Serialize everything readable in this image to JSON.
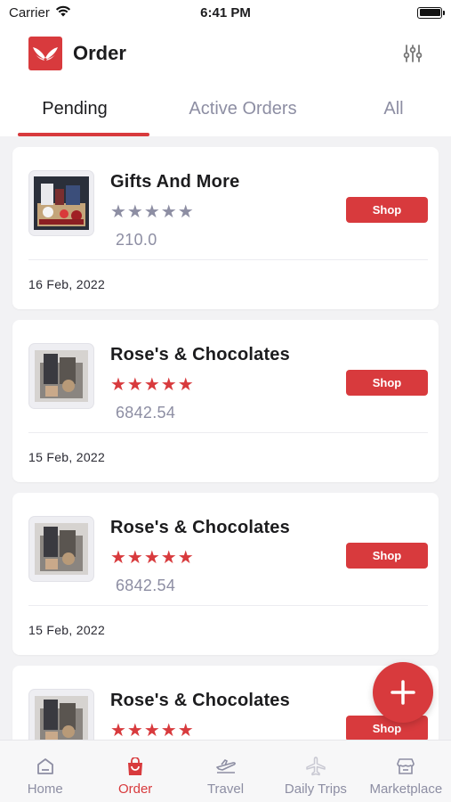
{
  "status_bar": {
    "carrier": "Carrier",
    "time": "6:41 PM"
  },
  "header": {
    "title": "Order"
  },
  "tabs": [
    {
      "label": "Pending",
      "active": true
    },
    {
      "label": "Active Orders",
      "active": false
    },
    {
      "label": "All",
      "active": false
    }
  ],
  "orders": [
    {
      "name": "Gifts And More",
      "stars": "★★★★★",
      "rating_color": "grey",
      "price": "210.0",
      "action": "Shop",
      "date": "16  Feb, 2022"
    },
    {
      "name": "Rose's & Chocolates",
      "stars": "★★★★★",
      "rating_color": "red",
      "price": "6842.54",
      "action": "Shop",
      "date": "15  Feb, 2022"
    },
    {
      "name": "Rose's & Chocolates",
      "stars": "★★★★★",
      "rating_color": "red",
      "price": "6842.54",
      "action": "Shop",
      "date": "15  Feb, 2022"
    },
    {
      "name": "Rose's & Chocolates",
      "stars": "★★★★★",
      "rating_color": "red",
      "price": "",
      "action": "Shop",
      "date": ""
    }
  ],
  "fab": {
    "icon": "plus-icon"
  },
  "bottom_nav": [
    {
      "label": "Home",
      "icon": "home-icon",
      "active": false
    },
    {
      "label": "Order",
      "icon": "shopping-bag-icon",
      "active": true
    },
    {
      "label": "Travel",
      "icon": "airplane-icon",
      "active": false
    },
    {
      "label": "Daily Trips",
      "icon": "plane-icon",
      "active": false
    },
    {
      "label": "Marketplace",
      "icon": "store-icon",
      "active": false
    }
  ],
  "colors": {
    "accent": "#d83a3d",
    "muted": "#8d8ea3",
    "background": "#f2f2f4"
  }
}
